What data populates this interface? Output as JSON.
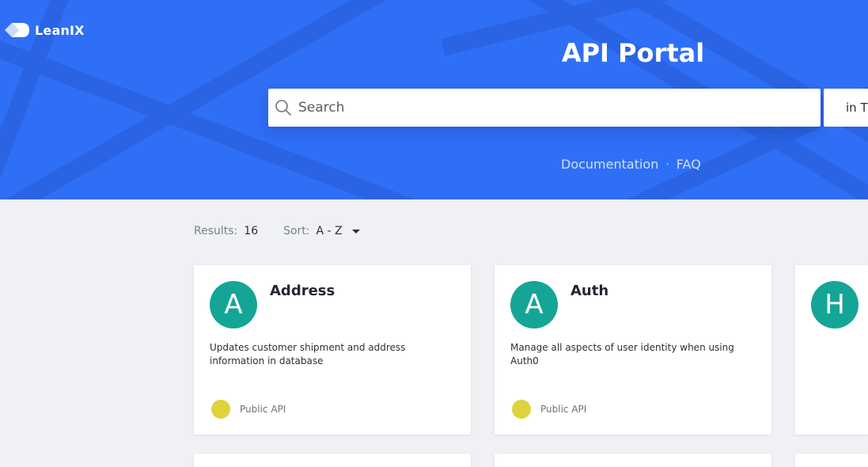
{
  "brand": {
    "name": "LeanIX"
  },
  "header": {
    "title": "API Portal",
    "search": {
      "placeholder": "Search",
      "value": ""
    },
    "scope_select": {
      "value": "in Ti"
    },
    "links": [
      {
        "label": "Documentation"
      },
      {
        "label": "FAQ"
      }
    ],
    "separator": "·"
  },
  "toolbar": {
    "results_label": "Results:",
    "results_count": "16",
    "sort_label": "Sort:",
    "sort_value": "A - Z"
  },
  "cards": [
    {
      "initial": "A",
      "name": "Address",
      "description": "Updates customer shipment and address information in database",
      "tag": "Public API"
    },
    {
      "initial": "A",
      "name": "Auth",
      "description": "Manage all aspects of user identity when using Auth0",
      "tag": "Public API"
    },
    {
      "initial": "H",
      "name": "",
      "description": "",
      "tag": ""
    }
  ],
  "colors": {
    "hero": "#2f6ff6",
    "avatar": "#15a596",
    "public_badge": "#dfd33c",
    "page_bg": "#f0f1f4"
  }
}
